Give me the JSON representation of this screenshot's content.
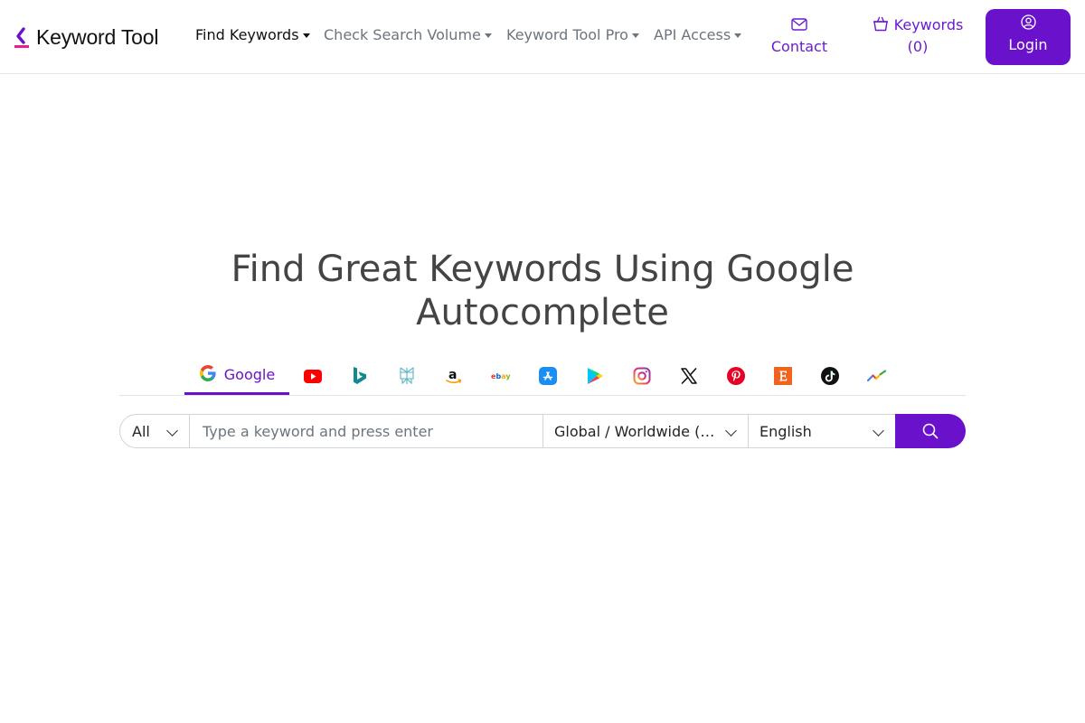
{
  "brand": {
    "name": "Keyword Tool",
    "accent": "#6a11cb"
  },
  "nav": {
    "items": [
      {
        "label": "Find Keywords",
        "active": true
      },
      {
        "label": "Check Search Volume",
        "active": false
      },
      {
        "label": "Keyword Tool Pro",
        "active": false
      },
      {
        "label": "API Access",
        "active": false
      }
    ],
    "contact_label": "Contact",
    "keywords_label": "Keywords",
    "keywords_count": "(0)",
    "login_label": "Login"
  },
  "hero": {
    "title_line1": "Find Great Keywords Using Google",
    "title_line2": "Autocomplete"
  },
  "tabs": [
    {
      "id": "google",
      "label": "Google",
      "icon": "google-icon",
      "active": true
    },
    {
      "id": "youtube",
      "icon": "youtube-icon"
    },
    {
      "id": "bing",
      "icon": "bing-icon"
    },
    {
      "id": "perplexity",
      "icon": "perplexity-icon"
    },
    {
      "id": "amazon",
      "icon": "amazon-icon"
    },
    {
      "id": "ebay",
      "icon": "ebay-icon"
    },
    {
      "id": "appstore",
      "icon": "app-store-icon"
    },
    {
      "id": "playstore",
      "icon": "play-store-icon"
    },
    {
      "id": "instagram",
      "icon": "instagram-icon"
    },
    {
      "id": "x",
      "icon": "x-icon"
    },
    {
      "id": "pinterest",
      "icon": "pinterest-icon"
    },
    {
      "id": "etsy",
      "icon": "etsy-icon"
    },
    {
      "id": "tiktok",
      "icon": "tiktok-icon"
    },
    {
      "id": "trends",
      "icon": "trends-icon"
    }
  ],
  "search": {
    "scope_value": "All",
    "placeholder": "Type a keyword and press enter",
    "value": "",
    "country_value": "Global / Worldwide (Google.com)",
    "language_value": "English"
  }
}
